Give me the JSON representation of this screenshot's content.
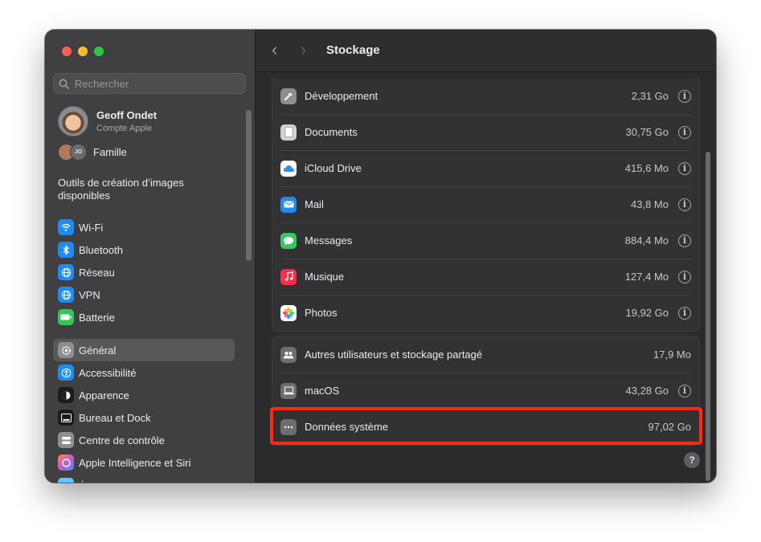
{
  "sidebar": {
    "search_placeholder": "Rechercher",
    "account": {
      "name": "Geoff Ondet",
      "subtitle": "Compte Apple"
    },
    "family": {
      "label": "Famille",
      "initials": "JO"
    },
    "promo": "Outils de création d’images disponibles",
    "network_items": [
      {
        "label": "Wi-Fi",
        "icon": "wifi-icon",
        "color": "#1e8cf5"
      },
      {
        "label": "Bluetooth",
        "icon": "bluetooth-icon",
        "color": "#1e8cf5"
      },
      {
        "label": "Réseau",
        "icon": "globe-icon",
        "color": "#1e8cf5"
      },
      {
        "label": "VPN",
        "icon": "vpn-globe-icon",
        "color": "#1e8cf5"
      },
      {
        "label": "Batterie",
        "icon": "battery-icon",
        "color": "#34c759"
      }
    ],
    "system_items": [
      {
        "label": "Général",
        "icon": "gear-icon",
        "color": "#8e8e93",
        "selected": true
      },
      {
        "label": "Accessibilité",
        "icon": "accessibility-icon",
        "color": "#1e8cf5"
      },
      {
        "label": "Apparence",
        "icon": "appearance-icon",
        "color": "#1c1c1e"
      },
      {
        "label": "Bureau et Dock",
        "icon": "dock-icon",
        "color": "#1c1c1e"
      },
      {
        "label": "Centre de contrôle",
        "icon": "control-center-icon",
        "color": "#8e8e93"
      },
      {
        "label": "Apple Intelligence et Siri",
        "icon": "siri-icon",
        "color": "#c55bd6"
      }
    ],
    "cut_item_label": "É"
  },
  "toolbar": {
    "title": "Stockage",
    "back_glyph": "‹",
    "forward_glyph": "›"
  },
  "storage_apps": [
    {
      "label": "Développement",
      "size": "2,31 Go",
      "icon": "hammer-icon",
      "color": "#8e8e93"
    },
    {
      "label": "Documents",
      "size": "30,75 Go",
      "icon": "document-icon",
      "color": "#d1d1d6"
    },
    {
      "label": "iCloud Drive",
      "size": "415,6 Mo",
      "icon": "icloud-icon",
      "color": "#ffffff"
    },
    {
      "label": "Mail",
      "size": "43,8 Mo",
      "icon": "mail-icon",
      "color": "#1e8cf5"
    },
    {
      "label": "Messages",
      "size": "884,4 Mo",
      "icon": "messages-icon",
      "color": "#34c759"
    },
    {
      "label": "Musique",
      "size": "127,4 Mo",
      "icon": "music-icon",
      "color": "#fa2d48"
    },
    {
      "label": "Photos",
      "size": "19,92 Go",
      "icon": "photos-icon",
      "color": "#ffffff"
    }
  ],
  "storage_system": [
    {
      "label": "Autres utilisateurs et stockage partagé",
      "size": "17,9 Mo",
      "icon": "users-icon",
      "color": "#6d6d72",
      "has_info": false
    },
    {
      "label": "macOS",
      "size": "43,28 Go",
      "icon": "laptop-icon",
      "color": "#6d6d72",
      "has_info": true
    },
    {
      "label": "Données système",
      "size": "97,02 Go",
      "icon": "ellipsis-icon",
      "color": "#6d6d72",
      "has_info": false
    }
  ],
  "info_glyph": "i",
  "help_glyph": "?",
  "highlight_color": "#ff2a10"
}
